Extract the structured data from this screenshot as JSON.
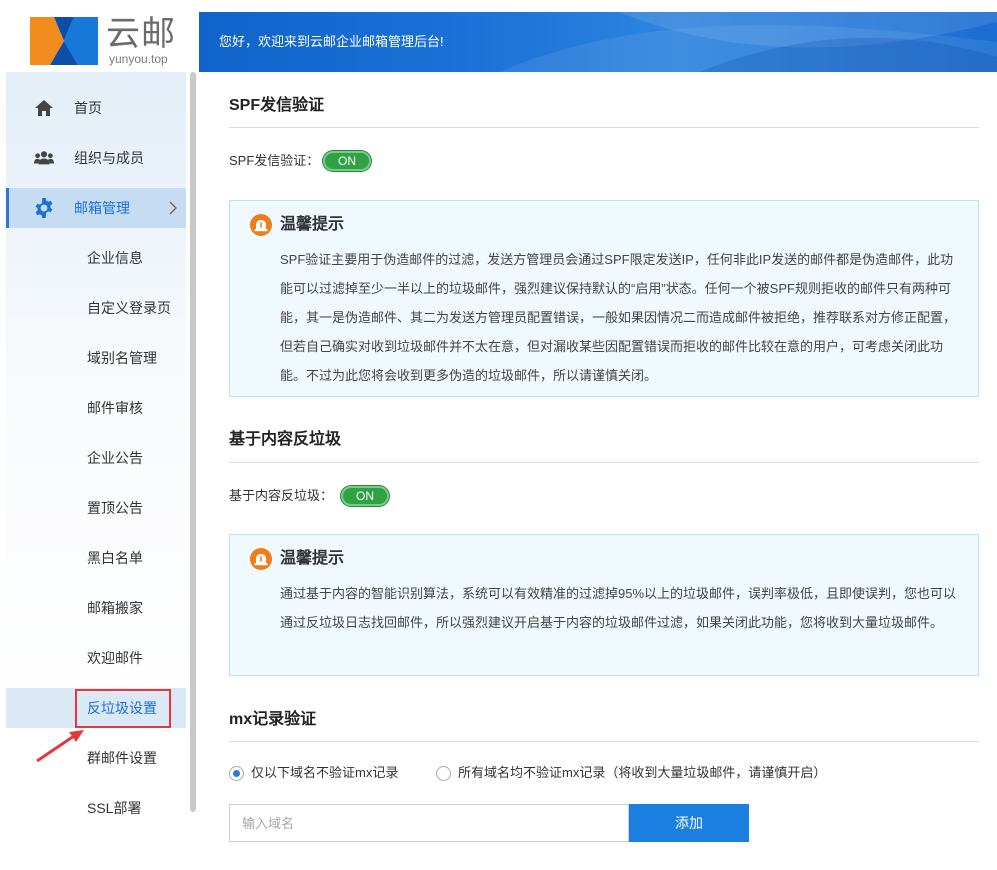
{
  "brand": {
    "name": "云邮",
    "domain": "yunyou.top",
    "colors": {
      "orange": "#f28c1f",
      "blue": "#1878d8",
      "dark_blue": "#0d4fa6"
    }
  },
  "banner": {
    "welcome": "您好，欢迎来到云邮企业邮箱管理后台!"
  },
  "sidebar": {
    "items": [
      {
        "label": "首页",
        "icon": "home-icon"
      },
      {
        "label": "组织与成员",
        "icon": "users-icon"
      },
      {
        "label": "邮箱管理",
        "icon": "gear-icon",
        "active": true
      }
    ],
    "sub_items": [
      {
        "label": "企业信息"
      },
      {
        "label": "自定义登录页"
      },
      {
        "label": "域别名管理"
      },
      {
        "label": "邮件审核"
      },
      {
        "label": "企业公告"
      },
      {
        "label": "置顶公告"
      },
      {
        "label": "黑白名单"
      },
      {
        "label": "邮箱搬家"
      },
      {
        "label": "欢迎邮件"
      },
      {
        "label": "反垃圾设置",
        "current": true
      },
      {
        "label": "群邮件设置"
      },
      {
        "label": "SSL部署"
      }
    ]
  },
  "spf": {
    "title": "SPF发信验证",
    "toggle_label": "SPF发信验证：",
    "toggle_state": "ON",
    "tip_title": "温馨提示",
    "tip_body": "SPF验证主要用于伪造邮件的过滤，发送方管理员会通过SPF限定发送IP，任何非此IP发送的邮件都是伪造邮件，此功能可以过滤掉至少一半以上的垃圾邮件，强烈建议保持默认的“启用”状态。任何一个被SPF规则拒收的邮件只有两种可能，其一是伪造邮件、其二为发送方管理员配置错误，一般如果因情况二而造成邮件被拒绝，推荐联系对方修正配置，但若自己确实对收到垃圾邮件并不太在意，但对漏收某些因配置错误而拒收的邮件比较在意的用户，可考虑关闭此功能。不过为此您将会收到更多伪造的垃圾邮件，所以请谨慎关闭。"
  },
  "content_filter": {
    "title": "基于内容反垃圾",
    "toggle_label": "基于内容反垃圾：",
    "toggle_state": "ON",
    "tip_title": "温馨提示",
    "tip_body": "通过基于内容的智能识别算法，系统可以有效精准的过滤掉95%以上的垃圾邮件，误判率极低，且即使误判，您也可以通过反垃圾日志找回邮件，所以强烈建议开启基于内容的垃圾邮件过滤，如果关闭此功能，您将收到大量垃圾邮件。"
  },
  "mx": {
    "title": "mx记录验证",
    "options": [
      {
        "label": "仅以下域名不验证mx记录",
        "checked": true
      },
      {
        "label": "所有域名均不验证mx记录（将收到大量垃圾邮件，请谨慎开启）",
        "checked": false
      }
    ],
    "input_placeholder": "输入域名",
    "input_value": "",
    "add_label": "添加"
  }
}
